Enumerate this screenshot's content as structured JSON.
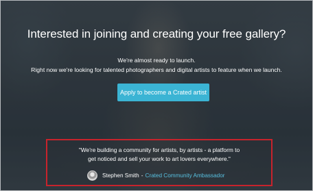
{
  "hero": {
    "headline": "Interested in joining and creating your free gallery?",
    "line1": "We're almost ready to launch.",
    "line2": "Right now we're looking for talented photographers and digital artists to feature when we launch.",
    "cta_label": "Apply to become a Crated artist"
  },
  "testimonial": {
    "quote_line1": "\"We're building a community for artists, by artists - a platform to",
    "quote_line2": "get noticed and sell your work to art lovers everywhere.\"",
    "author_name": "Stephen Smith",
    "separator": "-",
    "author_role": "Crated Community Ambassador"
  },
  "colors": {
    "cta_background": "#3bb4d4",
    "highlight_border": "#c8232c",
    "link": "#58c0e0"
  }
}
